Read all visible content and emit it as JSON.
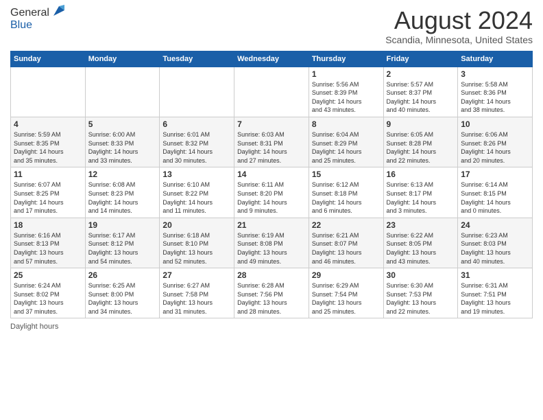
{
  "logo": {
    "line1": "General",
    "line2": "Blue"
  },
  "header": {
    "month": "August 2024",
    "location": "Scandia, Minnesota, United States"
  },
  "weekdays": [
    "Sunday",
    "Monday",
    "Tuesday",
    "Wednesday",
    "Thursday",
    "Friday",
    "Saturday"
  ],
  "weeks": [
    [
      {
        "day": "",
        "info": ""
      },
      {
        "day": "",
        "info": ""
      },
      {
        "day": "",
        "info": ""
      },
      {
        "day": "",
        "info": ""
      },
      {
        "day": "1",
        "info": "Sunrise: 5:56 AM\nSunset: 8:39 PM\nDaylight: 14 hours\nand 43 minutes."
      },
      {
        "day": "2",
        "info": "Sunrise: 5:57 AM\nSunset: 8:37 PM\nDaylight: 14 hours\nand 40 minutes."
      },
      {
        "day": "3",
        "info": "Sunrise: 5:58 AM\nSunset: 8:36 PM\nDaylight: 14 hours\nand 38 minutes."
      }
    ],
    [
      {
        "day": "4",
        "info": "Sunrise: 5:59 AM\nSunset: 8:35 PM\nDaylight: 14 hours\nand 35 minutes."
      },
      {
        "day": "5",
        "info": "Sunrise: 6:00 AM\nSunset: 8:33 PM\nDaylight: 14 hours\nand 33 minutes."
      },
      {
        "day": "6",
        "info": "Sunrise: 6:01 AM\nSunset: 8:32 PM\nDaylight: 14 hours\nand 30 minutes."
      },
      {
        "day": "7",
        "info": "Sunrise: 6:03 AM\nSunset: 8:31 PM\nDaylight: 14 hours\nand 27 minutes."
      },
      {
        "day": "8",
        "info": "Sunrise: 6:04 AM\nSunset: 8:29 PM\nDaylight: 14 hours\nand 25 minutes."
      },
      {
        "day": "9",
        "info": "Sunrise: 6:05 AM\nSunset: 8:28 PM\nDaylight: 14 hours\nand 22 minutes."
      },
      {
        "day": "10",
        "info": "Sunrise: 6:06 AM\nSunset: 8:26 PM\nDaylight: 14 hours\nand 20 minutes."
      }
    ],
    [
      {
        "day": "11",
        "info": "Sunrise: 6:07 AM\nSunset: 8:25 PM\nDaylight: 14 hours\nand 17 minutes."
      },
      {
        "day": "12",
        "info": "Sunrise: 6:08 AM\nSunset: 8:23 PM\nDaylight: 14 hours\nand 14 minutes."
      },
      {
        "day": "13",
        "info": "Sunrise: 6:10 AM\nSunset: 8:22 PM\nDaylight: 14 hours\nand 11 minutes."
      },
      {
        "day": "14",
        "info": "Sunrise: 6:11 AM\nSunset: 8:20 PM\nDaylight: 14 hours\nand 9 minutes."
      },
      {
        "day": "15",
        "info": "Sunrise: 6:12 AM\nSunset: 8:18 PM\nDaylight: 14 hours\nand 6 minutes."
      },
      {
        "day": "16",
        "info": "Sunrise: 6:13 AM\nSunset: 8:17 PM\nDaylight: 14 hours\nand 3 minutes."
      },
      {
        "day": "17",
        "info": "Sunrise: 6:14 AM\nSunset: 8:15 PM\nDaylight: 14 hours\nand 0 minutes."
      }
    ],
    [
      {
        "day": "18",
        "info": "Sunrise: 6:16 AM\nSunset: 8:13 PM\nDaylight: 13 hours\nand 57 minutes."
      },
      {
        "day": "19",
        "info": "Sunrise: 6:17 AM\nSunset: 8:12 PM\nDaylight: 13 hours\nand 54 minutes."
      },
      {
        "day": "20",
        "info": "Sunrise: 6:18 AM\nSunset: 8:10 PM\nDaylight: 13 hours\nand 52 minutes."
      },
      {
        "day": "21",
        "info": "Sunrise: 6:19 AM\nSunset: 8:08 PM\nDaylight: 13 hours\nand 49 minutes."
      },
      {
        "day": "22",
        "info": "Sunrise: 6:21 AM\nSunset: 8:07 PM\nDaylight: 13 hours\nand 46 minutes."
      },
      {
        "day": "23",
        "info": "Sunrise: 6:22 AM\nSunset: 8:05 PM\nDaylight: 13 hours\nand 43 minutes."
      },
      {
        "day": "24",
        "info": "Sunrise: 6:23 AM\nSunset: 8:03 PM\nDaylight: 13 hours\nand 40 minutes."
      }
    ],
    [
      {
        "day": "25",
        "info": "Sunrise: 6:24 AM\nSunset: 8:02 PM\nDaylight: 13 hours\nand 37 minutes."
      },
      {
        "day": "26",
        "info": "Sunrise: 6:25 AM\nSunset: 8:00 PM\nDaylight: 13 hours\nand 34 minutes."
      },
      {
        "day": "27",
        "info": "Sunrise: 6:27 AM\nSunset: 7:58 PM\nDaylight: 13 hours\nand 31 minutes."
      },
      {
        "day": "28",
        "info": "Sunrise: 6:28 AM\nSunset: 7:56 PM\nDaylight: 13 hours\nand 28 minutes."
      },
      {
        "day": "29",
        "info": "Sunrise: 6:29 AM\nSunset: 7:54 PM\nDaylight: 13 hours\nand 25 minutes."
      },
      {
        "day": "30",
        "info": "Sunrise: 6:30 AM\nSunset: 7:53 PM\nDaylight: 13 hours\nand 22 minutes."
      },
      {
        "day": "31",
        "info": "Sunrise: 6:31 AM\nSunset: 7:51 PM\nDaylight: 13 hours\nand 19 minutes."
      }
    ]
  ],
  "footer": {
    "label": "Daylight hours"
  }
}
